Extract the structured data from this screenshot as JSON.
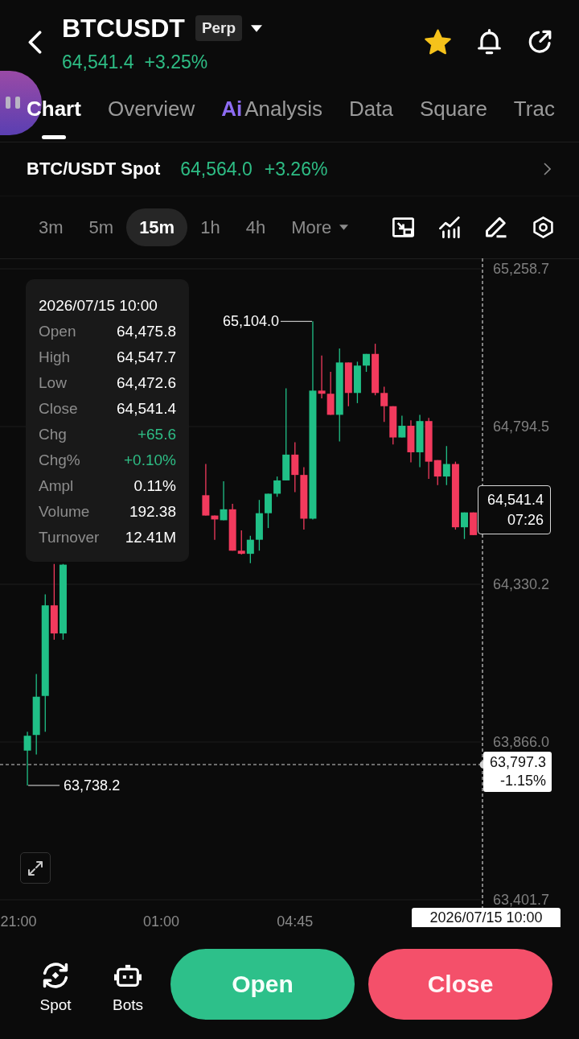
{
  "header": {
    "symbol": "BTCUSDT",
    "badge": "Perp",
    "price": "64,541.4",
    "change": "+3.25%",
    "favorite": true
  },
  "tabs": [
    {
      "label": "Chart",
      "selected": true
    },
    {
      "label": "Overview",
      "selected": false
    },
    {
      "label": "Analysis",
      "prefix": "Ai",
      "selected": false
    },
    {
      "label": "Data",
      "selected": false
    },
    {
      "label": "Square",
      "selected": false
    },
    {
      "label": "Trac",
      "selected": false
    }
  ],
  "spot_ticker": {
    "label": "BTC/USDT Spot",
    "price": "64,564.0",
    "change": "+3.26%"
  },
  "intervals": [
    {
      "label": "3m",
      "selected": false
    },
    {
      "label": "5m",
      "selected": false
    },
    {
      "label": "15m",
      "selected": true
    },
    {
      "label": "1h",
      "selected": false
    },
    {
      "label": "4h",
      "selected": false
    }
  ],
  "more_menu": {
    "label": "More"
  },
  "chart": {
    "chart_data": {
      "type": "candlestick",
      "grid": true,
      "categories": [
        "21:00",
        null,
        null,
        null,
        null,
        null,
        null,
        null,
        null,
        null,
        null,
        null,
        null,
        null,
        null,
        null,
        "01:00",
        null,
        null,
        null,
        null,
        null,
        null,
        null,
        null,
        null,
        null,
        null,
        null,
        null,
        null,
        "04:45",
        null,
        null,
        null,
        null,
        null,
        null,
        null,
        null,
        null,
        null,
        null,
        null,
        null,
        null,
        null,
        null,
        null,
        null,
        null,
        null
      ],
      "ohlc": [
        null,
        [
          63840.7,
          63895.9,
          63738.2,
          63884.4
        ],
        [
          63886.7,
          64065.9,
          63829.2,
          63999.3
        ],
        [
          64001.6,
          64300.4,
          63895.9,
          64268.2
        ],
        [
          64268.2,
          64390.0,
          64167.1,
          64185.5
        ],
        [
          64185.5,
          64390.0,
          64167.1,
          64388.0
        ],
        null,
        null,
        null,
        null,
        null,
        null,
        null,
        null,
        null,
        null,
        null,
        null,
        null,
        null,
        null,
        [
          64592.3,
          64684.2,
          64532.5,
          64532.5
        ],
        [
          64532.5,
          64532.5,
          64461.3,
          64521.0
        ],
        [
          64518.7,
          64633.6,
          64518.7,
          64550.9
        ],
        [
          64550.9,
          64567.0,
          64429.1,
          64429.1
        ],
        [
          64429.1,
          64488.8,
          64417.6,
          64419.9
        ],
        [
          64419.9,
          64472.7,
          64392.3,
          64461.3
        ],
        [
          64461.3,
          64578.5,
          64429.1,
          64539.4
        ],
        [
          64539.4,
          64596.8,
          64495.7,
          64596.8
        ],
        [
          64596.8,
          64647.4,
          64587.7,
          64635.9
        ],
        [
          64635.9,
          64907.1,
          64635.9,
          64711.8
        ],
        [
          64711.8,
          64748.5,
          64601.4,
          64652.0
        ],
        [
          64652.0,
          64675.0,
          64491.1,
          64523.3
        ],
        [
          64523.3,
          65104.0,
          64521.0,
          64900.2
        ],
        [
          64900.2,
          65003.6,
          64877.2,
          64891.0
        ],
        [
          64891.0,
          64955.4,
          64829.0,
          64829.0
        ],
        [
          64829.0,
          65024.3,
          64750.8,
          64983.0
        ],
        [
          64983.0,
          64983.0,
          64854.3,
          64893.3
        ],
        [
          64893.3,
          64985.3,
          64863.4,
          64973.8
        ],
        [
          64973.8,
          65008.2,
          64955.4,
          65008.2
        ],
        [
          65008.2,
          65038.1,
          64886.4,
          64893.3
        ],
        [
          64893.3,
          64911.7,
          64808.3,
          64854.3
        ],
        [
          64854.3,
          64854.3,
          64741.6,
          64762.3
        ],
        [
          64762.3,
          64826.7,
          64762.3,
          64796.8
        ],
        [
          64796.8,
          64812.9,
          64688.8,
          64718.7
        ],
        [
          64718.7,
          64829.0,
          64675.0,
          64810.6
        ],
        [
          64810.6,
          64819.8,
          64640.5,
          64691.1
        ],
        [
          64695.7,
          64695.7,
          64622.1,
          64647.4
        ],
        [
          64647.4,
          64737.0,
          64622.1,
          64684.2
        ],
        [
          64684.2,
          64691.1,
          64491.1,
          64498.0
        ],
        [
          64498.0,
          64541.7,
          64463.5,
          64541.7
        ],
        [
          64541.7,
          64541.7,
          64475.0,
          64475.0
        ]
      ],
      "ylim": [
        63401.7,
        65258.7
      ],
      "yticks": [
        {
          "value": 65258.7,
          "label": "65,258.7"
        },
        {
          "value": 64794.5,
          "label": "64,794.5"
        },
        {
          "value": 64330.2,
          "label": "64,330.2"
        },
        {
          "value": 63866.0,
          "label": "63,866.0"
        },
        {
          "value": 63401.7,
          "label": "63,401.7"
        }
      ]
    },
    "high_label": "65,104.0",
    "low_label": "63,738.2",
    "last_price": {
      "price": "64,541.4",
      "countdown": "07:26"
    },
    "crosshair": {
      "price": "63,797.3",
      "change": "-1.15%",
      "time": "2026/07/15 10:00"
    },
    "tooltip": {
      "time": "2026/07/15 10:00",
      "rows": [
        {
          "label": "Open",
          "value": "64,475.8",
          "kind": "neutral"
        },
        {
          "label": "High",
          "value": "64,547.7",
          "kind": "neutral"
        },
        {
          "label": "Low",
          "value": "64,472.6",
          "kind": "neutral"
        },
        {
          "label": "Close",
          "value": "64,541.4",
          "kind": "neutral"
        },
        {
          "label": "Chg",
          "value": "+65.6",
          "kind": "up"
        },
        {
          "label": "Chg%",
          "value": "+0.10%",
          "kind": "up"
        },
        {
          "label": "Ampl",
          "value": "0.11%",
          "kind": "neutral"
        },
        {
          "label": "Volume",
          "value": "192.38",
          "kind": "neutral"
        },
        {
          "label": "Turnover",
          "value": "12.41M",
          "kind": "neutral"
        }
      ]
    }
  },
  "bottom_bar": {
    "shortcuts": [
      {
        "label": "Spot",
        "kind": "exchange"
      },
      {
        "label": "Bots",
        "kind": "robot"
      }
    ],
    "actions": [
      {
        "label": "Open",
        "kind": "buy"
      },
      {
        "label": "Close",
        "kind": "sell"
      }
    ]
  }
}
